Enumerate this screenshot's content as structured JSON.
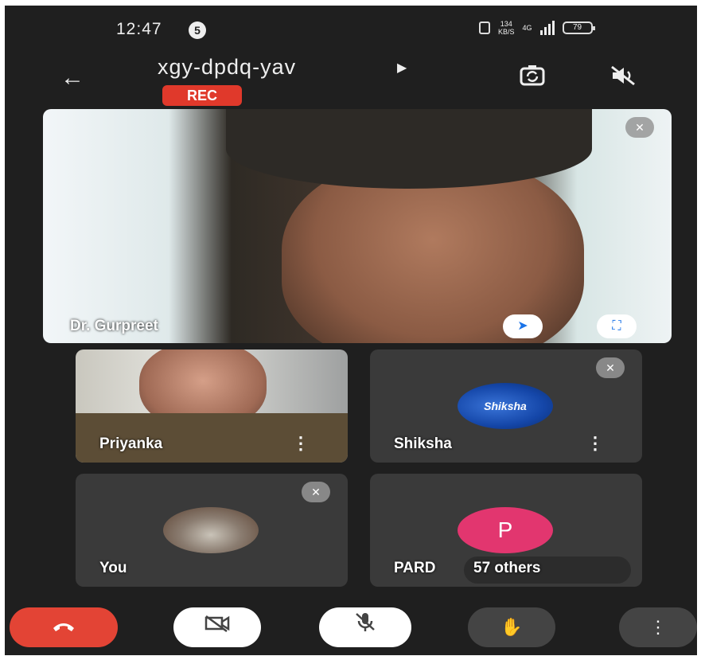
{
  "status_bar": {
    "time": "12:47",
    "notification_count": "5",
    "net_speed": "134",
    "net_speed_unit": "KB/S",
    "network_type": "4G",
    "battery": "79"
  },
  "header": {
    "meeting_code": "xgy-dpdq-yav",
    "recording_badge": "REC"
  },
  "main_tile": {
    "name": "Dr. Gurpreet"
  },
  "tiles": [
    {
      "name": "Priyanka"
    },
    {
      "name": "Shiksha",
      "avatar_text": "Shiksha"
    },
    {
      "name": "You"
    },
    {
      "name": "PARD",
      "avatar_letter": "P",
      "overflow_label": "57 others"
    }
  ],
  "icons": {
    "back": "arrow-left-icon",
    "switch_camera": "switch-camera-icon",
    "speaker_off": "speaker-off-icon",
    "pin": "pin-icon",
    "fullscreen": "fullscreen-icon",
    "mic_off": "mic-off-icon",
    "end_call": "end-call-icon",
    "camera_off": "camera-off-icon",
    "raise_hand": "raise-hand-icon",
    "more": "more-vertical-icon"
  },
  "colors": {
    "end_call": "#e34435",
    "rec": "#e0392b",
    "avatar_p": "#e2366f",
    "background": "#1f1f1f"
  }
}
